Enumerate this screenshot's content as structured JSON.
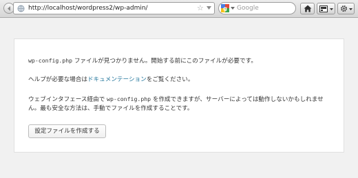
{
  "browser": {
    "url": "http://localhost/wordpress2/wp-admin/",
    "search_placeholder": "Google"
  },
  "page": {
    "message1_code": "wp-config.php",
    "message1_rest": " ファイルが見つかりません。開始する前にこのファイルが必要です。",
    "message2_before": "ヘルプが必要な場合は",
    "message2_link": "ドキュメンテーション",
    "message2_after": "をご覧ください。",
    "message3_before": "ウェブインタフェース経由で ",
    "message3_code": "wp-config.php",
    "message3_after": " を作成できますが、サーバーによっては動作しないかもしれませ",
    "message4": "ん。最も安全な方法は、手動でファイルを作成することです。",
    "button_label": "設定ファイルを作成する"
  },
  "colors": {
    "link": "#21759b",
    "page_bg": "#f1f1f1"
  }
}
